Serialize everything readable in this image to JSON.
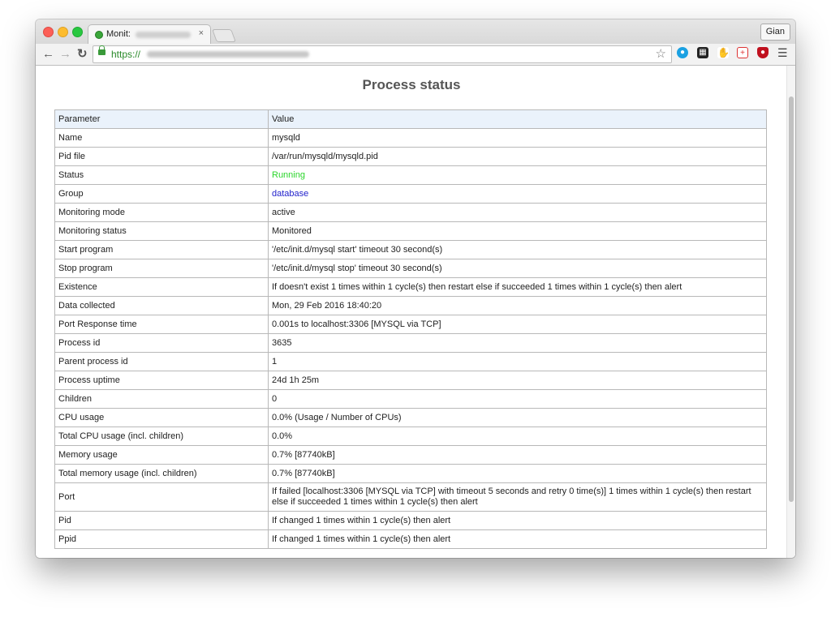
{
  "browser": {
    "tab_title": "Monit:",
    "tab_close": "×",
    "profile_name": "Gian",
    "url_scheme": "https://",
    "icons": {
      "back": "back-arrow-icon",
      "forward": "forward-arrow-icon",
      "reload": "reload-icon",
      "lock": "lock-icon",
      "bookmark": "star-icon",
      "menu": "hamburger-menu-icon"
    }
  },
  "page": {
    "title": "Process status",
    "columns": [
      "Parameter",
      "Value"
    ],
    "rows": [
      {
        "parameter": "Name",
        "value": "mysqld"
      },
      {
        "parameter": "Pid file",
        "value": "/var/run/mysqld/mysqld.pid"
      },
      {
        "parameter": "Status",
        "value": "Running"
      },
      {
        "parameter": "Group",
        "value": "database"
      },
      {
        "parameter": "Monitoring mode",
        "value": "active"
      },
      {
        "parameter": "Monitoring status",
        "value": "Monitored"
      },
      {
        "parameter": "Start program",
        "value": "'/etc/init.d/mysql start' timeout 30 second(s)"
      },
      {
        "parameter": "Stop program",
        "value": "'/etc/init.d/mysql stop' timeout 30 second(s)"
      },
      {
        "parameter": "Existence",
        "value": "If doesn't exist 1 times within 1 cycle(s) then restart else if succeeded 1 times within 1 cycle(s) then alert"
      },
      {
        "parameter": "Data collected",
        "value": "Mon, 29 Feb 2016 18:40:20"
      },
      {
        "parameter": "Port Response time",
        "value": "0.001s to localhost:3306 [MYSQL via TCP]"
      },
      {
        "parameter": "Process id",
        "value": "3635"
      },
      {
        "parameter": "Parent process id",
        "value": "1"
      },
      {
        "parameter": "Process uptime",
        "value": "24d 1h 25m"
      },
      {
        "parameter": "Children",
        "value": "0"
      },
      {
        "parameter": "CPU usage",
        "value": "0.0%   (Usage / Number of CPUs)"
      },
      {
        "parameter": "Total CPU usage (incl. children)",
        "value": "0.0%"
      },
      {
        "parameter": "Memory usage",
        "value": "0.7% [87740kB]"
      },
      {
        "parameter": "Total memory usage (incl. children)",
        "value": "0.7% [87740kB]"
      },
      {
        "parameter": "Port",
        "value": "If failed [localhost:3306 [MYSQL via TCP] with timeout 5 seconds and retry 0 time(s)] 1 times within 1 cycle(s) then restart else if succeeded 1 times within 1 cycle(s) then alert"
      },
      {
        "parameter": "Pid",
        "value": "If changed 1 times within 1 cycle(s) then alert"
      },
      {
        "parameter": "Ppid",
        "value": "If changed 1 times within 1 cycle(s) then alert"
      }
    ]
  },
  "colors": {
    "running": "#2bd52b",
    "link": "#2222cc",
    "header_bg": "#eaf2fb"
  }
}
